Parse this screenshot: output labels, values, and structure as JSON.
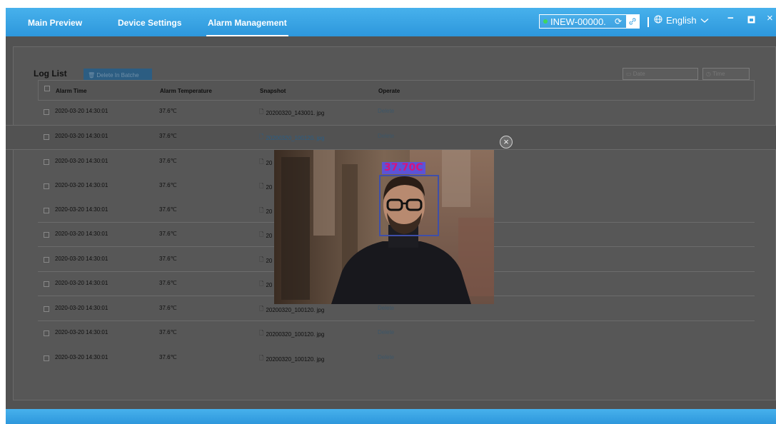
{
  "nav": {
    "tabs": [
      {
        "label": "Main Preview"
      },
      {
        "label": "Device Settings"
      },
      {
        "label": "Alarm Management"
      }
    ]
  },
  "device": {
    "name": "INEW-00000.",
    "status_color": "#3fd65c"
  },
  "language": {
    "label": "English"
  },
  "window": {
    "minimize": "−",
    "close": "×"
  },
  "log": {
    "title": "Log List",
    "batch_delete_label": "Delete In Batche",
    "date_placeholder": "Date",
    "time_placeholder": "Time",
    "columns": [
      "Alarm Time",
      "Alarm Temperature",
      "Snapshot",
      "Operate"
    ],
    "rows": [
      {
        "time": "2020-03-20 14:30:01",
        "temp": "37.6℃",
        "snapshot": "20200320_143001. jpg",
        "op": "Delete"
      },
      {
        "time": "2020-03-20 14:30:01",
        "temp": "37.6℃",
        "snapshot": "20200320_100120. jpg",
        "op": "Delete"
      },
      {
        "time": "2020-03-20 14:30:01",
        "temp": "37.6℃",
        "snapshot": "20",
        "op": ""
      },
      {
        "time": "2020-03-20 14:30:01",
        "temp": "37.6℃",
        "snapshot": "20",
        "op": ""
      },
      {
        "time": "2020-03-20 14:30:01",
        "temp": "37.6℃",
        "snapshot": "20",
        "op": ""
      },
      {
        "time": "2020-03-20 14:30:01",
        "temp": "37.6℃",
        "snapshot": "20",
        "op": ""
      },
      {
        "time": "2020-03-20 14:30:01",
        "temp": "37.6℃",
        "snapshot": "20",
        "op": ""
      },
      {
        "time": "2020-03-20 14:30:01",
        "temp": "37.6℃",
        "snapshot": "20",
        "op": ""
      },
      {
        "time": "2020-03-20 14:30:01",
        "temp": "37.6℃",
        "snapshot": "20200320_100120. jpg",
        "op": "Delete"
      },
      {
        "time": "2020-03-20 14:30:01",
        "temp": "37.6℃",
        "snapshot": "20200320_100120. jpg",
        "op": "Delete"
      },
      {
        "time": "2020-03-20 14:30:01",
        "temp": "37.6℃",
        "snapshot": "20200320_100120. jpg",
        "op": "Delete"
      }
    ]
  },
  "preview": {
    "temperature_label": "37.70C",
    "close": "×"
  }
}
